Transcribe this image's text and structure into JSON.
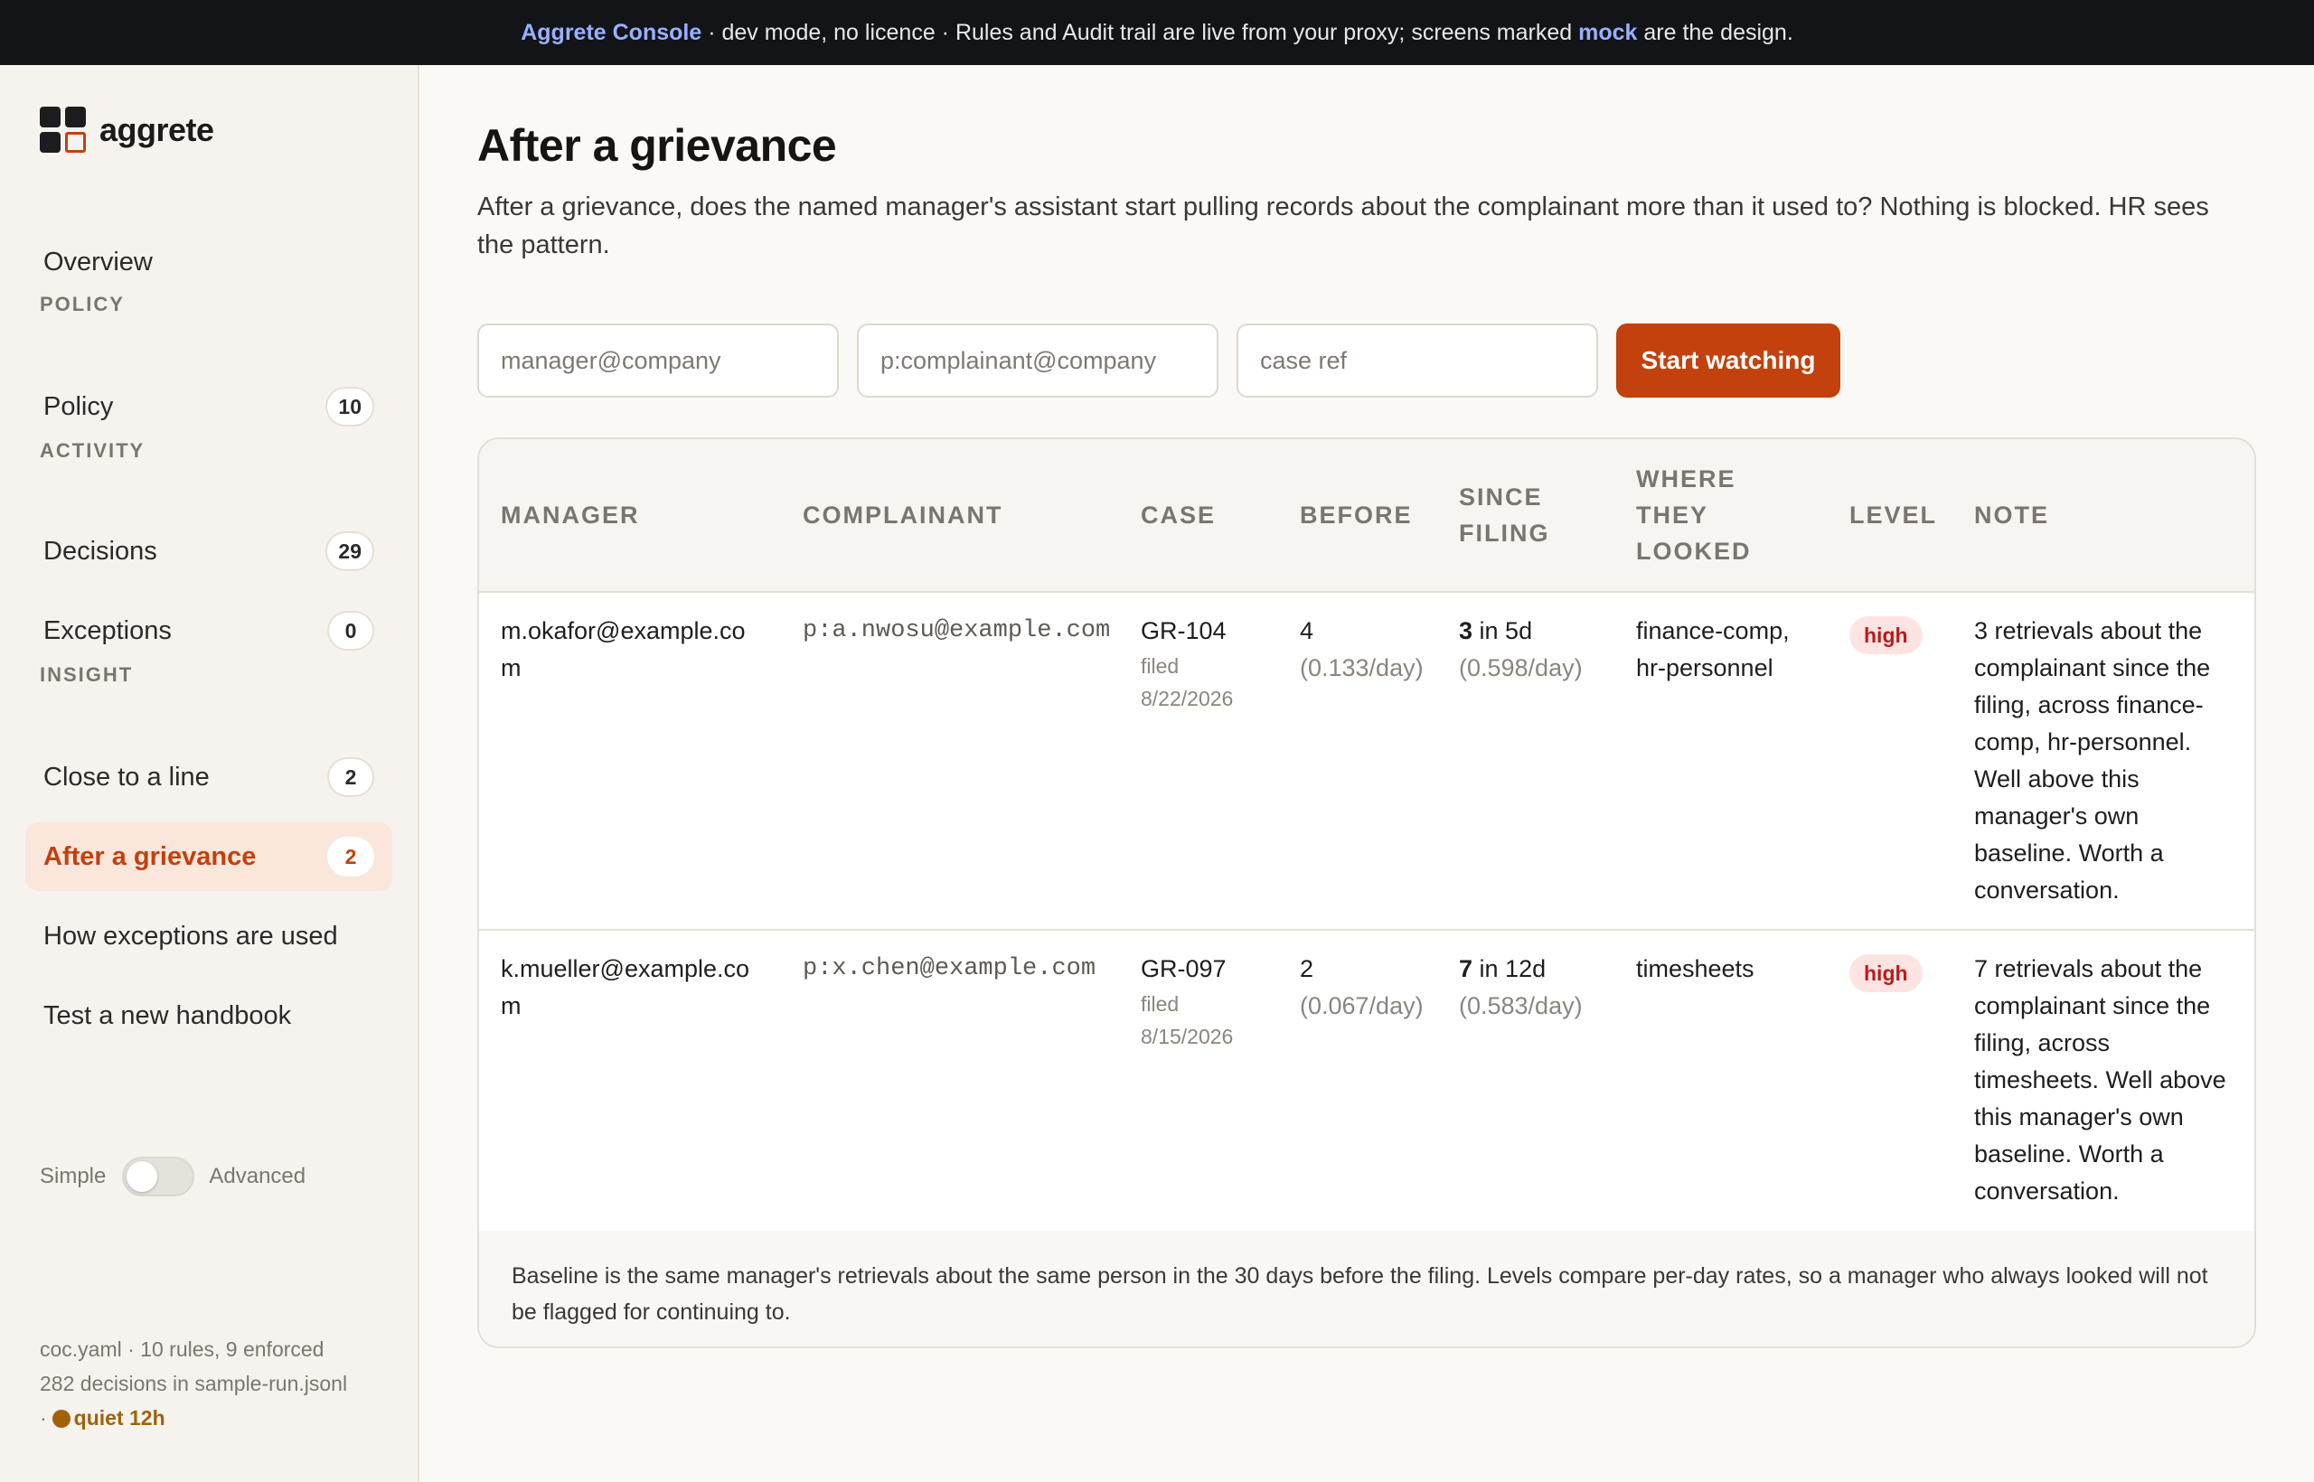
{
  "banner": {
    "brand": "Aggrete Console",
    "text1": " · dev mode, no licence · Rules and Audit trail are live from your proxy; screens marked ",
    "mock": "mock",
    "text2": " are the design."
  },
  "sidebar": {
    "logo_text": "aggrete",
    "overview": "Overview",
    "sections": {
      "policy": "POLICY",
      "activity": "ACTIVITY",
      "insight": "INSIGHT"
    },
    "items": {
      "policy": {
        "label": "Policy",
        "count": "10"
      },
      "decisions": {
        "label": "Decisions",
        "count": "29"
      },
      "exceptions": {
        "label": "Exceptions",
        "count": "0"
      },
      "close_to_line": {
        "label": "Close to a line",
        "count": "2"
      },
      "after_grievance": {
        "label": "After a grievance",
        "count": "2"
      },
      "exceptions_used": {
        "label": "How exceptions are used"
      },
      "test_handbook": {
        "label": "Test a new handbook"
      }
    },
    "toggle": {
      "left": "Simple",
      "right": "Advanced"
    },
    "footer": {
      "line1": "coc.yaml · 10 rules, 9 enforced",
      "line2": "282 decisions in sample-run.jsonl",
      "sep": "·",
      "quiet": "quiet 12h"
    }
  },
  "main": {
    "title": "After a grievance",
    "description": "After a grievance, does the named manager's assistant start pulling records about the complainant more than it used to? Nothing is blocked. HR sees the pattern.",
    "form": {
      "manager_placeholder": "manager@company",
      "complainant_placeholder": "p:complainant@company",
      "case_placeholder": "case ref",
      "submit": "Start watching"
    },
    "table": {
      "headers": {
        "manager": "MANAGER",
        "complainant": "COMPLAINANT",
        "case": "CASE",
        "before": "BEFORE",
        "since1": "SINCE",
        "since2": "FILING",
        "where1": "WHERE",
        "where2": "THEY",
        "where3": "LOOKED",
        "level": "LEVEL",
        "note": "NOTE"
      },
      "rows": [
        {
          "manager1": "m.okafor@example.co",
          "manager2": "m",
          "complainant": "p:a.nwosu@example.com",
          "case": "GR-104",
          "filed": "filed",
          "filed_date": "8/22/2026",
          "before_count": "4",
          "before_rate": "(0.133/day)",
          "since_count": "3",
          "since_period": " in 5d",
          "since_rate": "(0.598/day)",
          "where1": "finance-comp,",
          "where2": "hr-personnel",
          "level": "high",
          "note": "3 retrievals about the complainant since the filing, across finance-comp, hr-personnel. Well above this manager's own baseline. Worth a conversation."
        },
        {
          "manager1": "k.mueller@example.co",
          "manager2": "m",
          "complainant": "p:x.chen@example.com",
          "case": "GR-097",
          "filed": "filed",
          "filed_date": "8/15/2026",
          "before_count": "2",
          "before_rate": "(0.067/day)",
          "since_count": "7",
          "since_period": " in 12d",
          "since_rate": "(0.583/day)",
          "where1": "timesheets",
          "where2": "",
          "level": "high",
          "note": "7 retrievals about the complainant since the filing, across timesheets. Well above this manager's own baseline. Worth a conversation."
        }
      ],
      "footnote": "Baseline is the same manager's retrievals about the same person in the 30 days before the filing. Levels compare per-day rates, so a manager who always looked will not be flagged for continuing to."
    }
  },
  "colors": {
    "accent": "#c2410c",
    "active_bg": "#fbe6dc",
    "high_badge_bg": "#fde4e2",
    "high_badge_text": "#b91c1c",
    "banner_bg": "#121417",
    "banner_link": "#9ab0ff",
    "quiet": "#a16207"
  }
}
